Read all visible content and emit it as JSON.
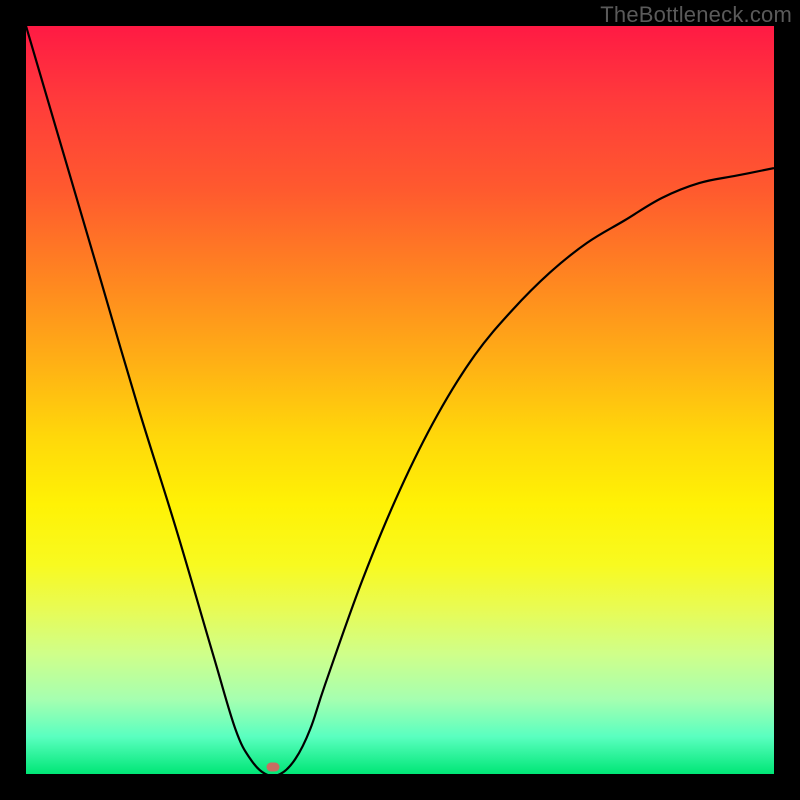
{
  "watermark": "TheBottleneck.com",
  "chart_data": {
    "type": "line",
    "title": "",
    "xlabel": "",
    "ylabel": "",
    "xlim": [
      0,
      100
    ],
    "ylim": [
      0,
      100
    ],
    "grid": false,
    "legend": false,
    "series": [
      {
        "name": "curve",
        "x": [
          0,
          5,
          10,
          15,
          20,
          25,
          28,
          30,
          32,
          34,
          36,
          38,
          40,
          45,
          50,
          55,
          60,
          65,
          70,
          75,
          80,
          85,
          90,
          95,
          100
        ],
        "y": [
          100,
          83,
          66,
          49,
          33,
          16,
          6,
          2,
          0,
          0,
          2,
          6,
          12,
          26,
          38,
          48,
          56,
          62,
          67,
          71,
          74,
          77,
          79,
          80,
          81
        ]
      }
    ],
    "marker": {
      "x": 33,
      "y": 1,
      "color": "#c96d62"
    },
    "background_gradient": {
      "top": "#ff1a44",
      "mid": "#fff205",
      "bottom": "#00e676"
    }
  }
}
